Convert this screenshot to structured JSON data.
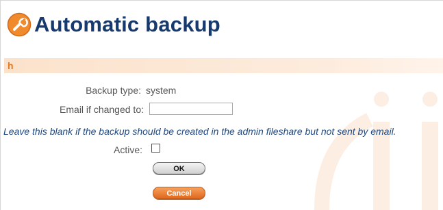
{
  "page": {
    "title": "Automatic backup",
    "title_icon": "wrench-icon"
  },
  "section": {
    "label": "h"
  },
  "form": {
    "backup_type_label": "Backup type:",
    "backup_type_value": "system",
    "email_label": "Email if changed to:",
    "email_value": "",
    "email_placeholder": "",
    "help_text": "Leave this blank if the backup should be created in the admin fileshare but not sent by email.",
    "active_label": "Active:",
    "active_checked": false
  },
  "buttons": {
    "ok_label": "OK",
    "cancel_label": "Cancel"
  },
  "colors": {
    "title": "#173a6e",
    "accent_orange": "#e8781c",
    "help_text": "#1e4880",
    "section_bar": "#fbe2cc"
  }
}
